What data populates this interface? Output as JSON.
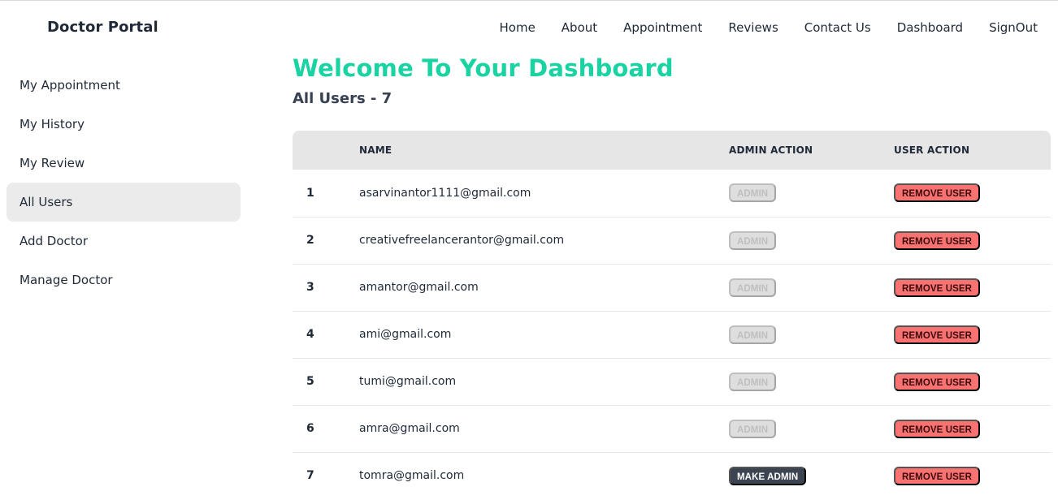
{
  "brand": "Doctor Portal",
  "nav": [
    "Home",
    "About",
    "Appointment",
    "Reviews",
    "Contact Us",
    "Dashboard",
    "SignOut"
  ],
  "sidebar": {
    "items": [
      {
        "label": "My Appointment"
      },
      {
        "label": "My History"
      },
      {
        "label": "My Review"
      },
      {
        "label": "All Users",
        "active": true
      },
      {
        "label": "Add Doctor"
      },
      {
        "label": "Manage Doctor"
      }
    ]
  },
  "main": {
    "title": "Welcome To Your Dashboard",
    "subtitle": "All Users - 7"
  },
  "table": {
    "headers": {
      "num": "",
      "name": "Name",
      "admin_action": "Admin Action",
      "user_action": "User Action"
    },
    "rows": [
      {
        "num": "1",
        "email": "asarvinantor1111@gmail.com",
        "admin_label": "Admin",
        "is_admin": true,
        "remove_label": "Remove User"
      },
      {
        "num": "2",
        "email": "creativefreelancerantor@gmail.com",
        "admin_label": "Admin",
        "is_admin": true,
        "remove_label": "Remove User"
      },
      {
        "num": "3",
        "email": "amantor@gmail.com",
        "admin_label": "Admin",
        "is_admin": true,
        "remove_label": "Remove User"
      },
      {
        "num": "4",
        "email": "ami@gmail.com",
        "admin_label": "Admin",
        "is_admin": true,
        "remove_label": "Remove User"
      },
      {
        "num": "5",
        "email": "tumi@gmail.com",
        "admin_label": "Admin",
        "is_admin": true,
        "remove_label": "Remove User"
      },
      {
        "num": "6",
        "email": "amra@gmail.com",
        "admin_label": "Admin",
        "is_admin": true,
        "remove_label": "Remove User"
      },
      {
        "num": "7",
        "email": "tomra@gmail.com",
        "admin_label": "Make Admin",
        "is_admin": false,
        "remove_label": "Remove User"
      }
    ]
  },
  "colors": {
    "accent": "#19d3a2",
    "remove": "#f87272",
    "make_admin": "#3d4451",
    "disabled": "#dedede"
  }
}
